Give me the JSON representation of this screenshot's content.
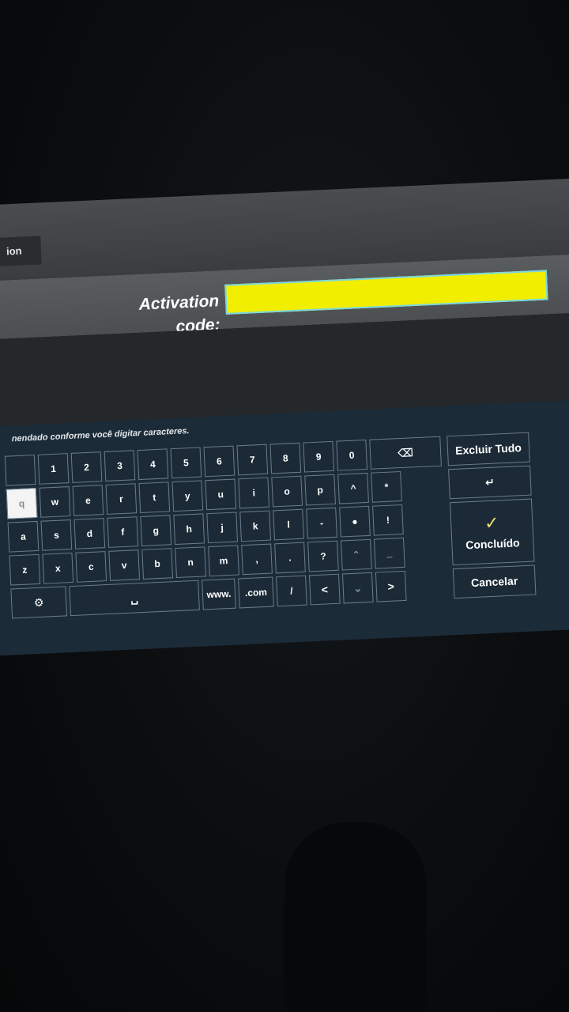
{
  "window": {
    "tab_fragment": "ion"
  },
  "activation": {
    "label": "Activation code:",
    "value": ""
  },
  "keyboard": {
    "hint": "nendado conforme você digitar caracteres.",
    "row1": [
      "1",
      "2",
      "3",
      "4",
      "5",
      "6",
      "7",
      "8",
      "9",
      "0"
    ],
    "row2": [
      "q",
      "w",
      "e",
      "r",
      "t",
      "y",
      "u",
      "i",
      "o",
      "p",
      "^",
      "*"
    ],
    "row3": [
      "a",
      "s",
      "d",
      "f",
      "g",
      "h",
      "j",
      "k",
      "l",
      "-",
      "●",
      "!"
    ],
    "row4": [
      "z",
      "x",
      "c",
      "v",
      "b",
      "n",
      "m",
      ",",
      ".",
      "?",
      "⌃",
      "_"
    ],
    "row5": {
      "settings": "⚙",
      "space": "␣",
      "www": "www.",
      "com": ".com",
      "slash": "/",
      "left": "<",
      "down": "⌄",
      "right": ">"
    },
    "backspace": "⌫",
    "clear_all": "Excluir Tudo",
    "enter": "↵",
    "done_icon": "✓",
    "done": "Concluído",
    "cancel": "Cancelar"
  }
}
